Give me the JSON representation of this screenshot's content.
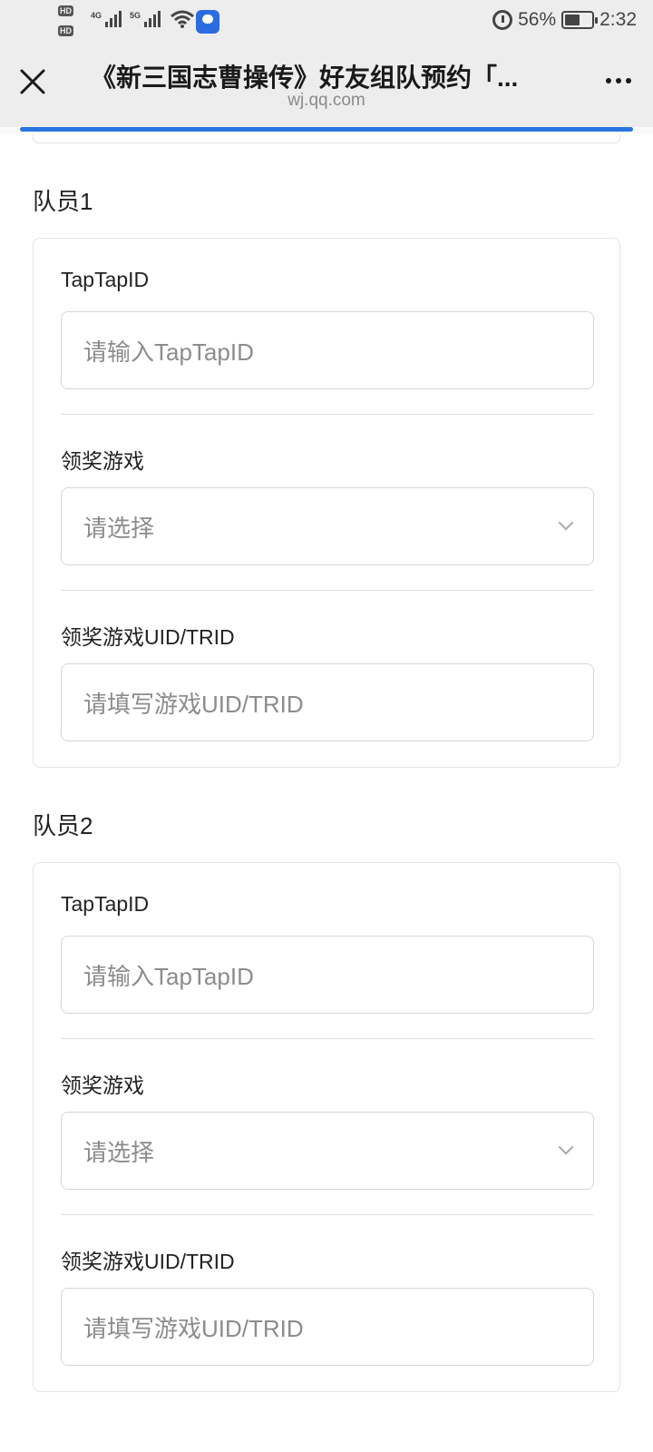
{
  "status_bar": {
    "hd1": "HD",
    "hd2": "HD",
    "signal1": "4G",
    "signal2": "5G",
    "battery_percent": "56%",
    "time": "2:32",
    "battery_level": 0.56
  },
  "header": {
    "title": "《新三国志曹操传》好友组队预约「...",
    "url": "wj.qq.com",
    "close_icon": "close-icon",
    "more_icon": "more-icon"
  },
  "members": [
    {
      "title": "队员1",
      "tap_label": "TapTapID",
      "tap_placeholder": "请输入TapTapID",
      "game_label": "领奖游戏",
      "game_placeholder": "请选择",
      "uid_label": "领奖游戏UID/TRID",
      "uid_placeholder": "请填写游戏UID/TRID"
    },
    {
      "title": "队员2",
      "tap_label": "TapTapID",
      "tap_placeholder": "请输入TapTapID",
      "game_label": "领奖游戏",
      "game_placeholder": "请选择",
      "uid_label": "领奖游戏UID/TRID",
      "uid_placeholder": "请填写游戏UID/TRID"
    }
  ],
  "colors": {
    "accent": "#2a74e0",
    "border": "#d6d6d6",
    "placeholder": "#8c8c8c"
  }
}
